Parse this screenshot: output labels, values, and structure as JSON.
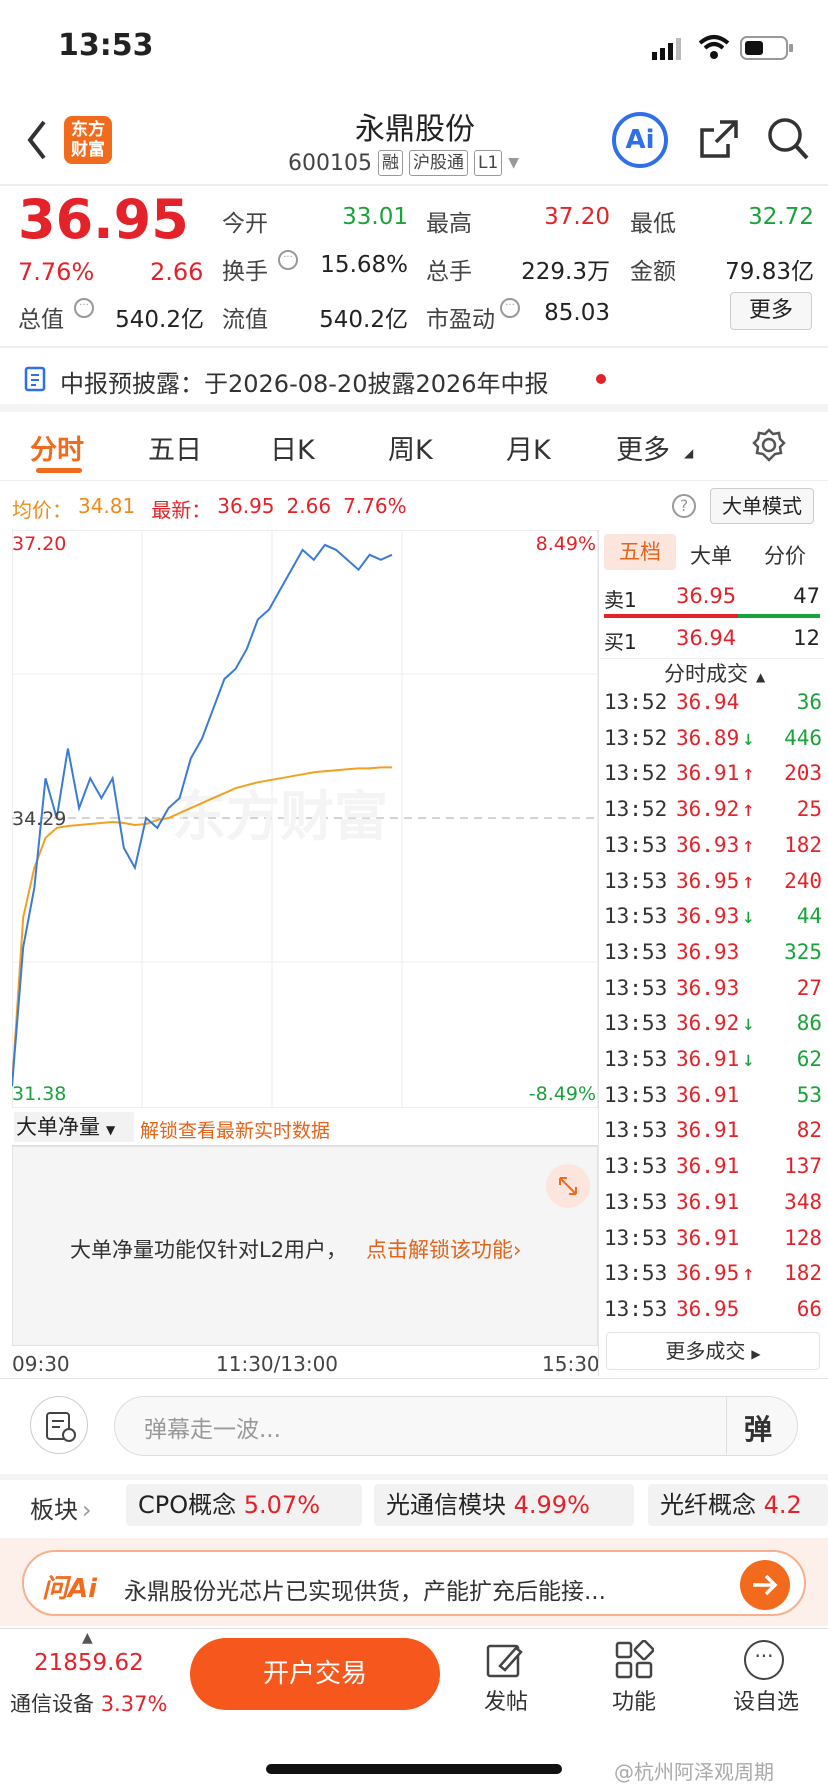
{
  "status": {
    "time": "13:53"
  },
  "header": {
    "name": "永鼎股份",
    "code": "600105",
    "badges": [
      "融",
      "沪股通",
      "L1"
    ],
    "ai": "Ai",
    "logo_text": "东方\n财富"
  },
  "quote": {
    "price": "36.95",
    "pct": "7.76%",
    "chg": "2.66",
    "stats": [
      {
        "label": "今开",
        "value": "33.01",
        "color": "green"
      },
      {
        "label": "最高",
        "value": "37.20",
        "color": "red"
      },
      {
        "label": "最低",
        "value": "32.72",
        "color": "green"
      },
      {
        "label": "换手",
        "value": "15.68%",
        "color": "dark"
      },
      {
        "label": "总手",
        "value": "229.3万",
        "color": "dark"
      },
      {
        "label": "金额",
        "value": "79.83亿",
        "color": "dark"
      },
      {
        "label": "总值",
        "value": "540.2亿",
        "color": "dark"
      },
      {
        "label": "流值",
        "value": "540.2亿",
        "color": "dark"
      },
      {
        "label": "市盈动",
        "value": "85.03",
        "color": "dark"
      }
    ],
    "more": "更多"
  },
  "notice": {
    "text": "中报预披露：于2026-08-20披露2026年中报"
  },
  "tabs": [
    "分时",
    "五日",
    "日K",
    "周K",
    "月K",
    "更多"
  ],
  "avg_line": {
    "avg_label": "均价：",
    "avg": "34.81",
    "latest_label": "最新：",
    "latest": "36.95",
    "chg": "2.66",
    "pct": "7.76%",
    "big_mode": "大单模式"
  },
  "chart_data": {
    "type": "line",
    "title": "",
    "high_label": "37.20",
    "low_label": "31.38",
    "mid_label": "34.29",
    "high_pct": "8.49%",
    "low_pct": "-8.49%",
    "x_labels": [
      "09:30",
      "11:30/13:00",
      "15:30"
    ],
    "ylim": [
      31.38,
      37.2
    ],
    "series": [
      {
        "values": [
          31.6,
          33.0,
          33.6,
          34.7,
          34.3,
          35.0,
          34.4,
          34.7,
          34.5,
          34.7,
          34.0,
          33.8,
          34.3,
          34.2,
          34.4,
          34.5,
          34.9,
          35.1,
          35.4,
          35.7,
          35.8,
          36.0,
          36.3,
          36.4,
          36.6,
          36.8,
          37.0,
          36.9,
          37.05,
          37.0,
          36.9,
          36.8,
          36.95,
          36.9,
          36.95
        ],
        "color": "#3a7bd5"
      },
      {
        "values": [
          31.6,
          33.3,
          33.8,
          34.1,
          34.2,
          34.22,
          34.23,
          34.24,
          34.25,
          34.26,
          34.25,
          34.23,
          34.24,
          34.28,
          34.3,
          34.35,
          34.4,
          34.45,
          34.5,
          34.55,
          34.6,
          34.63,
          34.66,
          34.68,
          34.7,
          34.72,
          34.74,
          34.76,
          34.77,
          34.78,
          34.79,
          34.8,
          34.8,
          34.81,
          34.81
        ],
        "color": "#f3a020"
      }
    ]
  },
  "watermark": "东方财富",
  "sub_panel": {
    "dropdown": "大单净量",
    "unlock": "解锁查看最新实时数据",
    "msg": "大单净量功能仅针对L2用户，",
    "link": "点击解锁该功能"
  },
  "side": {
    "tabs": [
      "五档",
      "大单",
      "分价"
    ],
    "sell": {
      "label": "卖1",
      "price": "36.95",
      "vol": "47"
    },
    "buy": {
      "label": "买1",
      "price": "36.94",
      "vol": "12"
    },
    "ticks_title": "分时成交",
    "ticks": [
      {
        "t": "13:52",
        "p": "36.94",
        "a": "",
        "v": "36",
        "pc": "red",
        "vc": "green"
      },
      {
        "t": "13:52",
        "p": "36.89",
        "a": "↓",
        "v": "446",
        "pc": "red",
        "vc": "green"
      },
      {
        "t": "13:52",
        "p": "36.91",
        "a": "↑",
        "v": "203",
        "pc": "red",
        "vc": "red"
      },
      {
        "t": "13:52",
        "p": "36.92",
        "a": "↑",
        "v": "25",
        "pc": "red",
        "vc": "red"
      },
      {
        "t": "13:53",
        "p": "36.93",
        "a": "↑",
        "v": "182",
        "pc": "red",
        "vc": "red"
      },
      {
        "t": "13:53",
        "p": "36.95",
        "a": "↑",
        "v": "240",
        "pc": "red",
        "vc": "red"
      },
      {
        "t": "13:53",
        "p": "36.93",
        "a": "↓",
        "v": "44",
        "pc": "red",
        "vc": "green"
      },
      {
        "t": "13:53",
        "p": "36.93",
        "a": "",
        "v": "325",
        "pc": "red",
        "vc": "green"
      },
      {
        "t": "13:53",
        "p": "36.93",
        "a": "",
        "v": "27",
        "pc": "red",
        "vc": "red"
      },
      {
        "t": "13:53",
        "p": "36.92",
        "a": "↓",
        "v": "86",
        "pc": "red",
        "vc": "green"
      },
      {
        "t": "13:53",
        "p": "36.91",
        "a": "↓",
        "v": "62",
        "pc": "red",
        "vc": "green"
      },
      {
        "t": "13:53",
        "p": "36.91",
        "a": "",
        "v": "53",
        "pc": "red",
        "vc": "green"
      },
      {
        "t": "13:53",
        "p": "36.91",
        "a": "",
        "v": "82",
        "pc": "red",
        "vc": "red"
      },
      {
        "t": "13:53",
        "p": "36.91",
        "a": "",
        "v": "137",
        "pc": "red",
        "vc": "red"
      },
      {
        "t": "13:53",
        "p": "36.91",
        "a": "",
        "v": "348",
        "pc": "red",
        "vc": "red"
      },
      {
        "t": "13:53",
        "p": "36.91",
        "a": "",
        "v": "128",
        "pc": "red",
        "vc": "red"
      },
      {
        "t": "13:53",
        "p": "36.95",
        "a": "↑",
        "v": "182",
        "pc": "red",
        "vc": "red"
      },
      {
        "t": "13:53",
        "p": "36.95",
        "a": "",
        "v": "66",
        "pc": "red",
        "vc": "red"
      }
    ],
    "more": "更多成交"
  },
  "danmaku": {
    "placeholder": "弹幕走一波...",
    "send": "弹"
  },
  "sectors": {
    "label": "板块",
    "items": [
      {
        "name": "CPO概念",
        "pct": "5.07%"
      },
      {
        "name": "光通信模块",
        "pct": "4.99%"
      },
      {
        "name": "光纤概念",
        "pct": "4.2"
      }
    ]
  },
  "ai_bar": {
    "logo": "问Ai",
    "text": "永鼎股份光芯片已实现供货，产能扩充后能接..."
  },
  "bottom": {
    "index_value": "21859.62",
    "index_name": "通信设备",
    "index_pct": "3.37%",
    "trade": "开户交易",
    "post": "发帖",
    "func": "功能",
    "watch": "设自选"
  },
  "footer_watermark": "@杭州阿泽观周期"
}
